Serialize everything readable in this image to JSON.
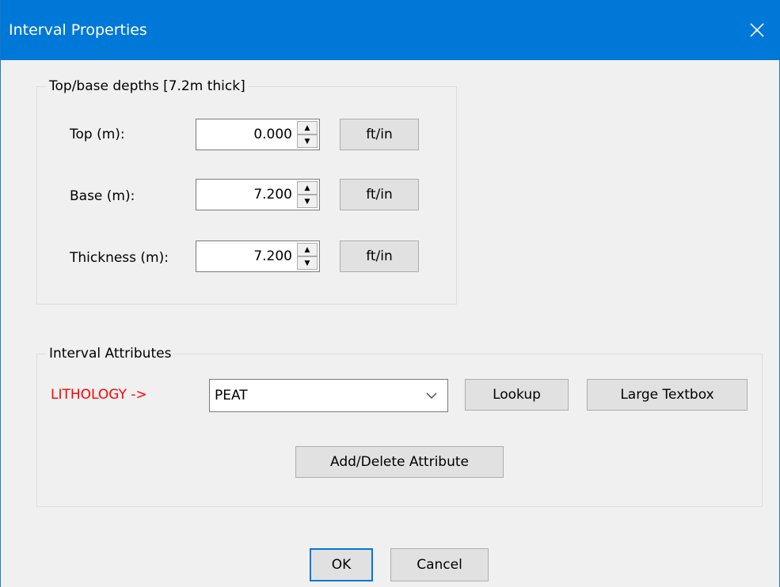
{
  "window": {
    "title": "Interval Properties",
    "close_icon": "close-icon"
  },
  "depths": {
    "legend": "Top/base depths  [7.2m thick]",
    "rows": [
      {
        "label": "Top (m):",
        "value": "0.000",
        "button": "ft/in"
      },
      {
        "label": "Base (m):",
        "value": "7.200",
        "button": "ft/in"
      },
      {
        "label": "Thickness (m):",
        "value": "7.200",
        "button": "ft/in"
      }
    ]
  },
  "attributes": {
    "legend": "Interval Attributes",
    "lithology_label": "LITHOLOGY ->",
    "lithology_label_color": "#ff0000",
    "lithology_value": "PEAT",
    "lookup_label": "Lookup",
    "large_textbox_label": "Large Textbox",
    "add_delete_label": "Add/Delete Attribute"
  },
  "footer": {
    "ok_label": "OK",
    "cancel_label": "Cancel"
  },
  "colors": {
    "titlebar": "#0078d7",
    "dialog_bg": "#f0f0f0",
    "button_bg": "#e1e1e1"
  }
}
